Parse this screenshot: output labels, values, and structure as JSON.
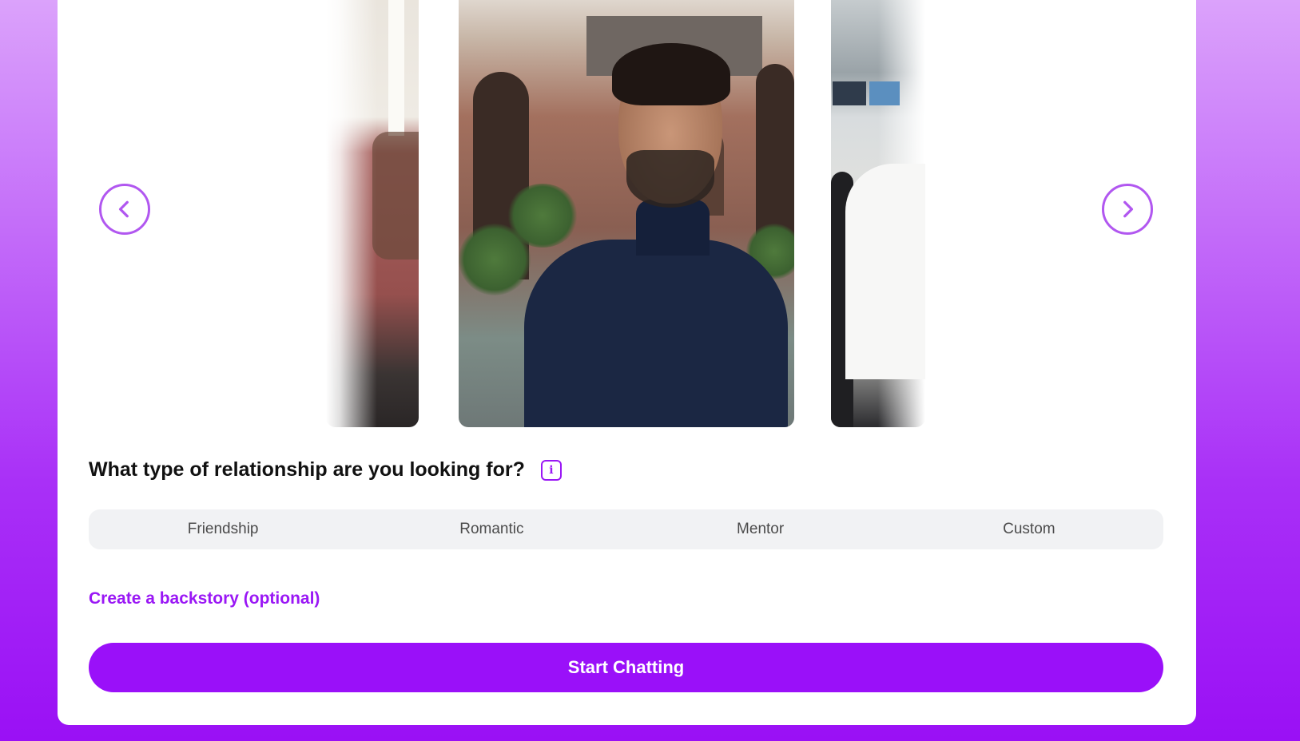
{
  "carousel": {
    "prev_icon": "chevron-left-icon",
    "next_icon": "chevron-right-icon",
    "accent_color": "#b157f0"
  },
  "relationship": {
    "question": "What type of relationship are you looking for?",
    "info_icon": "i",
    "options": [
      {
        "label": "Friendship"
      },
      {
        "label": "Romantic"
      },
      {
        "label": "Mentor"
      },
      {
        "label": "Custom"
      }
    ]
  },
  "backstory": {
    "link_label": "Create a backstory (optional)"
  },
  "cta": {
    "label": "Start Chatting",
    "color": "#9a10f9"
  }
}
